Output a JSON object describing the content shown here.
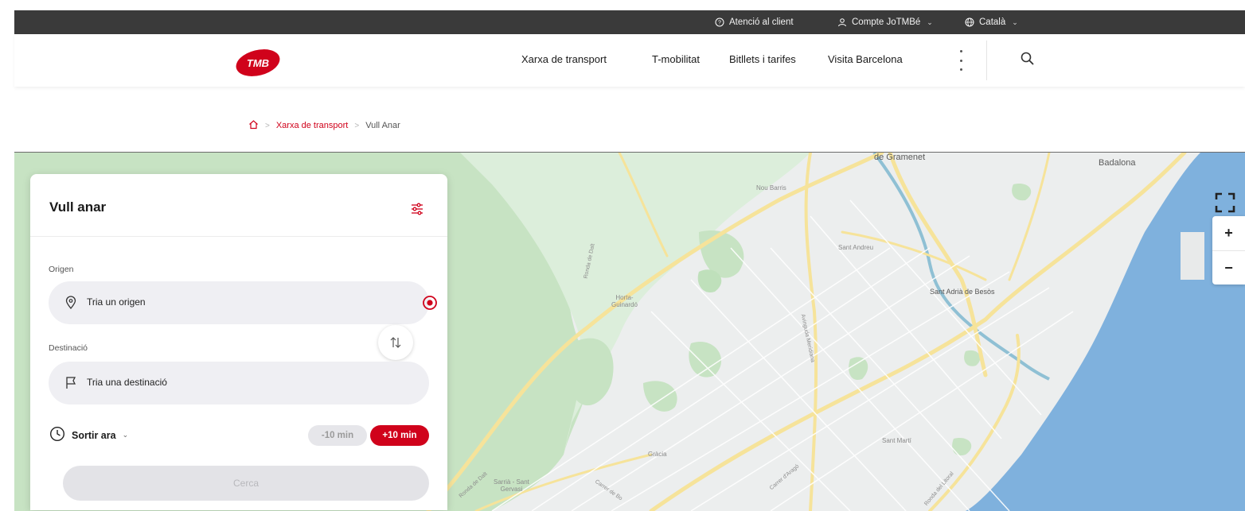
{
  "topbar": {
    "customer_service": "Atenció al client",
    "account": "Compte JoTMBé",
    "language": "Català"
  },
  "header": {
    "logo_text": "TMB",
    "nav": [
      "Xarxa de transport",
      "T-mobilitat",
      "Bitllets i tarifes",
      "Visita Barcelona"
    ]
  },
  "breadcrumb": {
    "home_icon": "home-icon",
    "link": "Xarxa de transport",
    "current": "Vull Anar"
  },
  "panel": {
    "title": "Vull anar",
    "origin_label": "Origen",
    "origin_placeholder": "Tria un origen",
    "destination_label": "Destinació",
    "destination_placeholder": "Tria una destinació",
    "time_mode": "Sortir ara",
    "minus_10": "-10 min",
    "plus_10": "+10 min",
    "search_label": "Cerca"
  },
  "map": {
    "labels": {
      "gramenet": "de Gramenet",
      "badalona": "Badalona",
      "nou_barris": "Nou Barris",
      "sant_andreu": "Sant Andreu",
      "sant_adria": "Sant Adrià de Besòs",
      "horta": "Horta-\nGuinardó",
      "gracia": "Gràcia",
      "sant_marti": "Sant Martí",
      "sarria": "Sarrià - Sant\nGervasi"
    },
    "streets": {
      "ronda_dalt": "Ronda de Dalt",
      "ronda_dalt_2": "Ronda de Dalt",
      "meridiana": "Avinguda Meridiana",
      "arago": "Carrer d'Aragó",
      "carrer_bo": "Carrer de Bo",
      "ronda_litoral": "Ronda del Litoral"
    }
  },
  "colors": {
    "accent": "#d0021b",
    "topbar": "#3a3a3a",
    "sea": "#7fb1dd",
    "park": "#c7e3c3",
    "road": "#f6e39a"
  }
}
